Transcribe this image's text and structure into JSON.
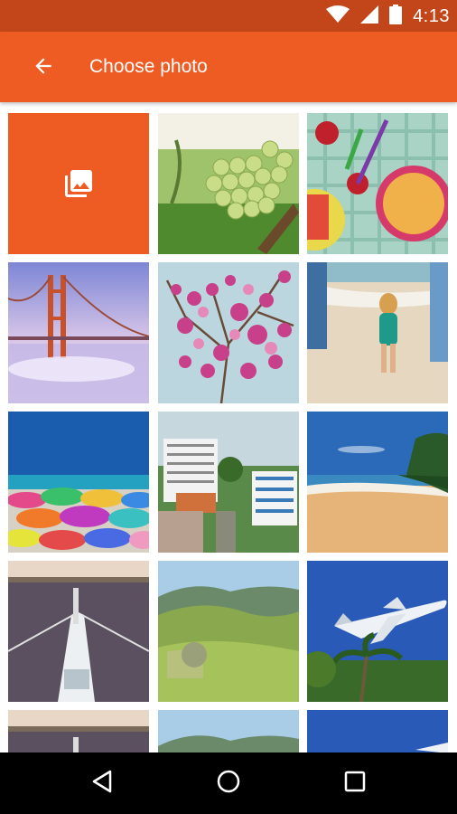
{
  "status_bar": {
    "time": "4:13",
    "icons": [
      "wifi-icon",
      "cell-signal-icon",
      "battery-icon"
    ]
  },
  "toolbar": {
    "title": "Choose photo",
    "back_icon": "arrow-back-icon"
  },
  "colors": {
    "accent": "#ee5c24",
    "status_bar": "#c2461a",
    "nav_bar": "#000000"
  },
  "gallery_tile": {
    "icon": "photo-library-icon"
  },
  "photos": [
    {
      "subject": "grapes"
    },
    {
      "subject": "fruit-picnic"
    },
    {
      "subject": "golden-gate-bridge"
    },
    {
      "subject": "pink-blossoms"
    },
    {
      "subject": "beach-family"
    },
    {
      "subject": "beach-umbrellas"
    },
    {
      "subject": "town-buildings"
    },
    {
      "subject": "sandy-beach"
    },
    {
      "subject": "boat-bow"
    },
    {
      "subject": "green-hills"
    },
    {
      "subject": "airplane-palms"
    },
    {
      "subject": "boat-bow"
    },
    {
      "subject": "green-hills"
    },
    {
      "subject": "airplane-palms"
    }
  ],
  "nav_bar": {
    "icons": [
      "back-triangle-icon",
      "home-circle-icon",
      "recents-square-icon"
    ]
  }
}
